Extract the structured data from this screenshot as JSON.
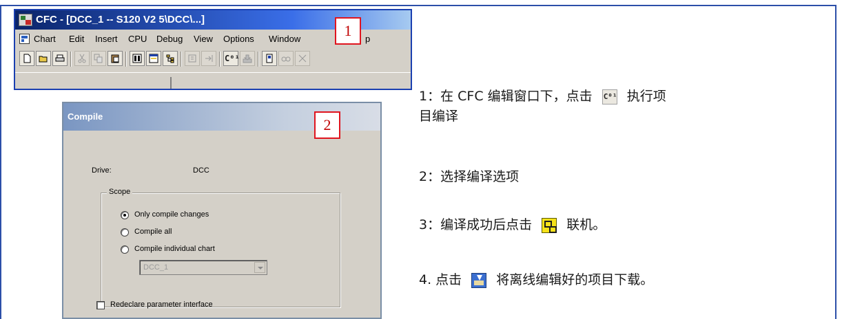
{
  "cfc_window": {
    "title": "CFC - [DCC_1 -- S120 V2 5\\DCC\\...]",
    "menu": [
      "Chart",
      "Edit",
      "Insert",
      "CPU",
      "Debug",
      "View",
      "Options",
      "Window",
      "p"
    ],
    "toolbar_icons": [
      "new-icon",
      "open-icon",
      "print-icon",
      "cut-icon",
      "copy-icon",
      "paste-icon",
      "chart-view-icon",
      "sheet-view-icon",
      "catalog-icon",
      "run-icon",
      "next-icon",
      "compile-icon",
      "download-icon",
      "test-icon",
      "watch-icon",
      "more-icon"
    ]
  },
  "compile_dialog": {
    "title": "Compile",
    "drive_label": "Drive:",
    "drive_value": "DCC",
    "scope_label": "Scope",
    "options": [
      {
        "label": "Only compile changes",
        "checked": true
      },
      {
        "label": "Compile all",
        "checked": false
      },
      {
        "label": "Compile individual chart",
        "checked": false
      }
    ],
    "chart_select_value": "DCC_1",
    "redeclare_label": "Redeclare parameter interface",
    "redeclare_checked": false
  },
  "callouts": [
    "1",
    "2"
  ],
  "instructions": {
    "step1_prefix": "1：在 CFC 编辑窗口下，点击",
    "step1_suffix": "执行项",
    "step1_line2": "目编译",
    "step2": "2：选择编译选项",
    "step3_prefix": "3：编译成功后点击",
    "step3_suffix": "联机。",
    "step4_prefix": "4. 点击",
    "step4_suffix": "将离线编辑好的项目下载。"
  },
  "compile_icon_glyph": "C⁰¹",
  "colors": {
    "frame_border": "#2c4fa8",
    "title_bar": "#0a246a",
    "callout_red": "#e0141e",
    "online_icon": "#f6e21a"
  }
}
